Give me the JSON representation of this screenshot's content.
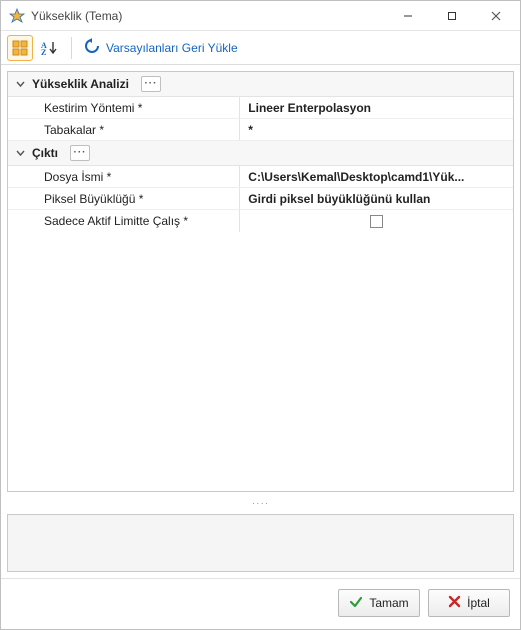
{
  "window": {
    "title": "Yükseklik (Tema)"
  },
  "toolbar": {
    "restore_defaults": "Varsayılanları Geri Yükle"
  },
  "groups": [
    {
      "title": "Yükseklik Analizi",
      "rows": [
        {
          "label": "Kestirim Yöntemi *",
          "value": "Lineer Enterpolasyon",
          "bold": true,
          "type": "text"
        },
        {
          "label": "Tabakalar *",
          "value": "*",
          "bold": true,
          "type": "text"
        }
      ]
    },
    {
      "title": "Çıktı",
      "rows": [
        {
          "label": "Dosya İsmi *",
          "value": "C:\\Users\\Kemal\\Desktop\\camd1\\Yük...",
          "bold": true,
          "type": "text"
        },
        {
          "label": "Piksel Büyüklüğü *",
          "value": "Girdi piksel büyüklüğünü kullan",
          "bold": true,
          "type": "text"
        },
        {
          "label": "Sadece Aktif Limitte Çalış *",
          "value": "",
          "bold": false,
          "type": "checkbox",
          "checked": false
        }
      ]
    }
  ],
  "buttons": {
    "ok": "Tamam",
    "cancel": "İptal"
  },
  "colors": {
    "ok_icon": "#2e9b3a",
    "cancel_icon": "#c62828",
    "link": "#1565c0"
  }
}
